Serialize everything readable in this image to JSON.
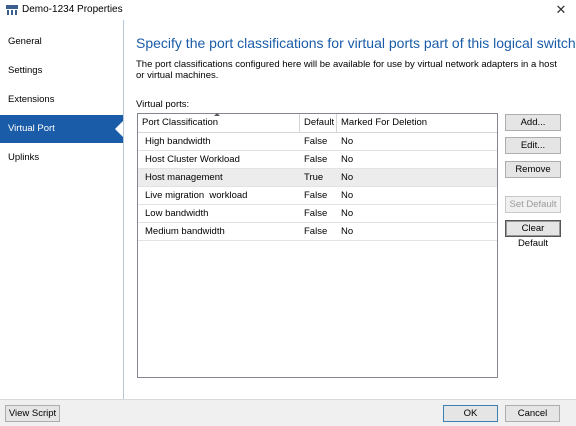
{
  "window": {
    "title": "Demo-1234 Properties",
    "close_glyph": "✕",
    "app_icon": "virtual-switch-icon"
  },
  "sidebar": {
    "items": [
      {
        "label": "General"
      },
      {
        "label": "Settings"
      },
      {
        "label": "Extensions"
      },
      {
        "label": "Virtual Port",
        "active": true
      },
      {
        "label": "Uplinks"
      }
    ]
  },
  "main": {
    "heading": "Specify the port classifications for virtual ports part of this logical switch",
    "description": "The port classifications configured here will be available for use by virtual network adapters in a host or virtual machines.",
    "list_label": "Virtual ports:",
    "columns": [
      "Port Classification",
      "Default",
      "Marked For Deletion"
    ],
    "rows": [
      {
        "name": "High bandwidth",
        "default": "False",
        "deletion": "No"
      },
      {
        "name": "Host Cluster Workload",
        "default": "False",
        "deletion": "No"
      },
      {
        "name": "Host management",
        "default": "True",
        "deletion": "No"
      },
      {
        "name": "Live migration  workload",
        "default": "False",
        "deletion": "No"
      },
      {
        "name": "Low bandwidth",
        "default": "False",
        "deletion": "No"
      },
      {
        "name": "Medium bandwidth",
        "default": "False",
        "deletion": "No"
      }
    ],
    "buttons": {
      "add": "Add...",
      "edit": "Edit...",
      "remove": "Remove",
      "set_default": "Set Default",
      "clear_default": "Clear Default"
    }
  },
  "footer": {
    "view_script": "View Script",
    "ok": "OK",
    "cancel": "Cancel"
  },
  "colors": {
    "accent": "#1a5ca8",
    "selected_row": "#ececec"
  }
}
